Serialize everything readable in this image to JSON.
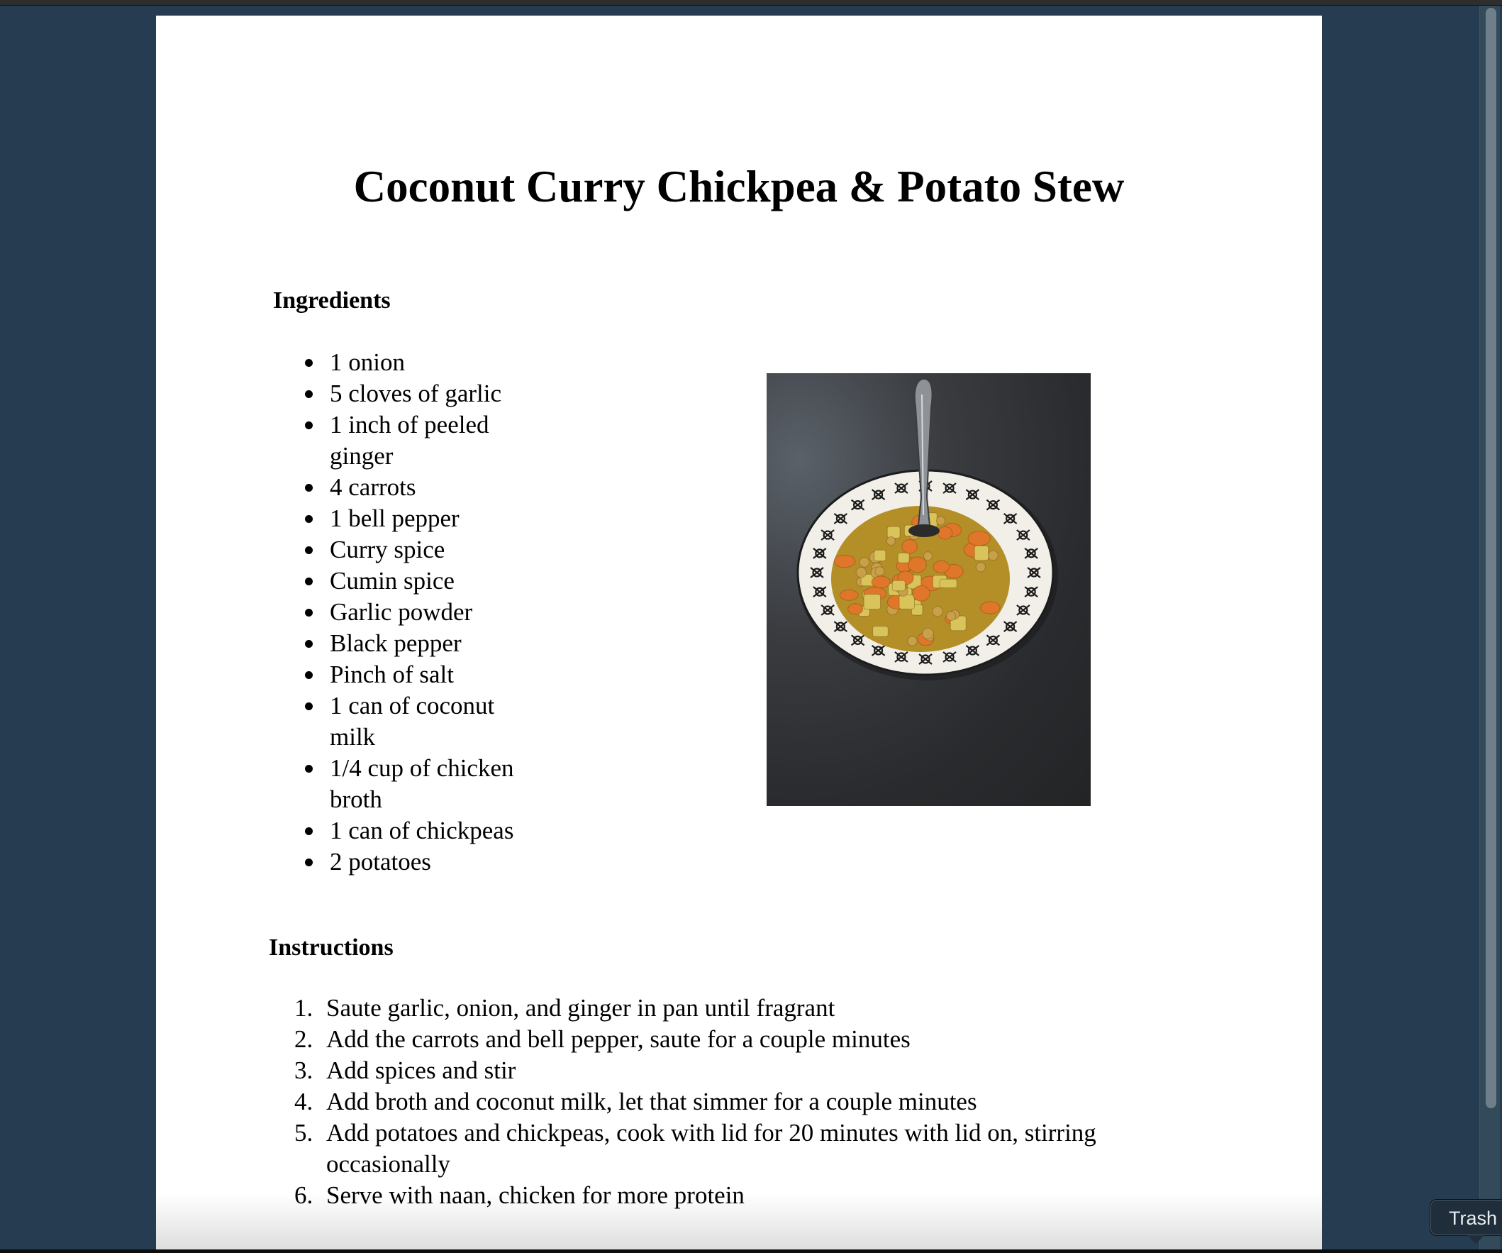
{
  "document": {
    "title": "Coconut Curry Chickpea & Potato Stew",
    "ingredients": {
      "heading": "Ingredients",
      "items": [
        "1 onion",
        "5 cloves of garlic",
        "1 inch of peeled ginger",
        "4 carrots",
        "1 bell pepper",
        "Curry spice",
        "Cumin spice",
        "Garlic powder",
        "Black pepper",
        "Pinch of salt",
        "1 can of coconut milk",
        "1/4 cup of chicken broth",
        "1 can of chickpeas",
        "2 potatoes"
      ]
    },
    "photo": {
      "alt": "Bowl of coconut curry chickpea and potato stew with a spoon",
      "colors": {
        "background": "#2a2b2e",
        "bowl_rim": "#f2f0ea",
        "stew": "#b9962a",
        "carrot": "#e0762a",
        "potato": "#d8c45a",
        "chickpea": "#c9a04a"
      }
    },
    "instructions": {
      "heading": "Instructions",
      "steps": [
        {
          "num": "1.",
          "text": "Saute garlic, onion, and ginger in pan until fragrant"
        },
        {
          "num": "2.",
          "text": "Add the carrots and bell pepper, saute for a couple minutes"
        },
        {
          "num": "3.",
          "text": "Add spices and stir"
        },
        {
          "num": "4.",
          "text": "Add broth and coconut milk, let that simmer for a couple minutes"
        },
        {
          "num": "5.",
          "text": "Add potatoes and chickpeas, cook with lid for 20 minutes with lid on, stirring occasionally"
        },
        {
          "num": "6.",
          "text": "Serve with naan, chicken for more protein"
        }
      ]
    }
  },
  "dock_tooltip": {
    "label": "Trash"
  },
  "theme": {
    "viewer_background": "#263c51",
    "page_background": "#ffffff",
    "text_color": "#000000"
  }
}
